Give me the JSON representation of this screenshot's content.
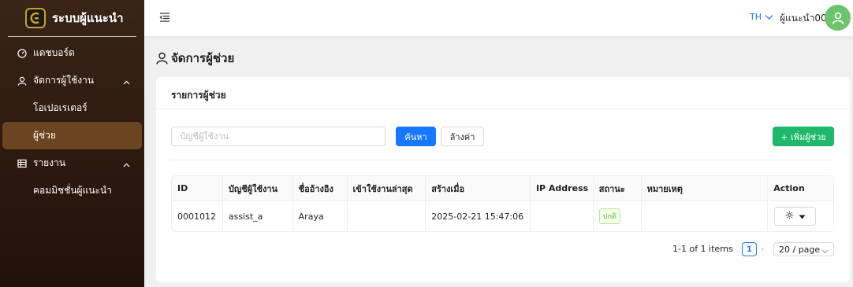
{
  "brand": {
    "title": "ระบบผู้แนะนำ"
  },
  "sidebar": {
    "items": [
      {
        "label": "แดชบอร์ด",
        "icon": "dashboard-icon"
      },
      {
        "label": "จัดการผู้ใช้งาน",
        "icon": "user-icon",
        "expanded": true,
        "children": [
          {
            "label": "โอเปอเรเตอร์"
          },
          {
            "label": "ผู้ช่วย",
            "active": true
          }
        ]
      },
      {
        "label": "รายงาน",
        "icon": "table-icon",
        "expanded": true,
        "children": [
          {
            "label": "คอมมิชชั่นผู้แนะนำ"
          }
        ]
      }
    ]
  },
  "header": {
    "lang": "TH",
    "username": "ผู้แนะนำ001"
  },
  "page": {
    "title": "จัดการผู้ช่วย"
  },
  "card": {
    "title": "รายการผู้ช่วย",
    "search_placeholder": "บัญชีผู้ใช้งาน",
    "search_label": "ค้นหา",
    "clear_label": "ล้างค่า",
    "add_label": "+ เพิ่มผู้ช่วย"
  },
  "table": {
    "columns": [
      "ID",
      "บัญชีผู้ใช้งาน",
      "ชื่ออ้างอิง",
      "เข้าใช้งานล่าสุด",
      "สร้างเมื่อ",
      "IP Address",
      "สถานะ",
      "หมายเหตุ",
      "Action"
    ],
    "rows": [
      {
        "id": "0001012",
        "username": "assist_a",
        "ref_name": "Araya",
        "last_login": "",
        "created": "2025-02-21 15:47:06",
        "ip": "",
        "status": "ปกติ",
        "note": ""
      }
    ]
  },
  "pagination": {
    "total": "1-1 of 1 items",
    "current": "1",
    "page_size": "20 / page"
  },
  "colors": {
    "sidebar_bg": "#2b180e",
    "active_item": "#6b4422",
    "primary": "#1677ff",
    "success": "#1fb86a",
    "avatar": "#6cc56c"
  }
}
